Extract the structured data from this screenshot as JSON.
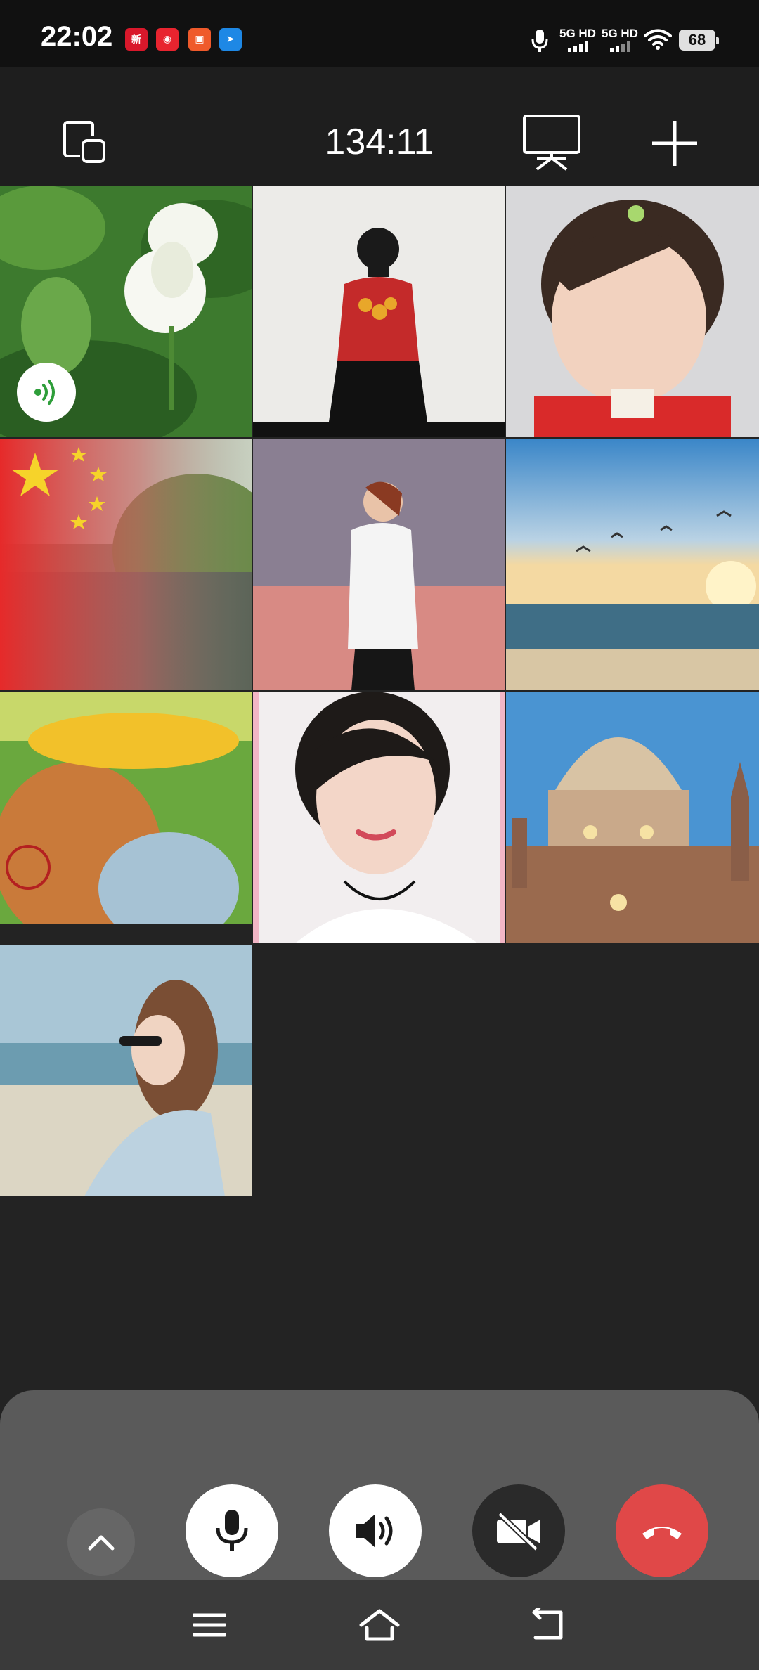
{
  "status_bar": {
    "time": "22:02",
    "network_1": "5G HD",
    "network_2": "5G HD",
    "battery": "68",
    "app_icons": [
      "news-app-icon",
      "music-app-icon",
      "video-app-icon",
      "map-app-icon"
    ],
    "app_icon_colors": [
      "#d9182b",
      "#e8242f",
      "#ef5a2b",
      "#1e88e5"
    ]
  },
  "call": {
    "timer": "134:11",
    "icons": {
      "left": "switch-window-icon",
      "screen": "screen-share-icon",
      "add": "add-participant-icon"
    }
  },
  "participants": [
    {
      "name": "participant-lotus",
      "speaking": true
    },
    {
      "name": "participant-red-sweater"
    },
    {
      "name": "participant-baby"
    },
    {
      "name": "participant-flag-lake"
    },
    {
      "name": "participant-white-coat"
    },
    {
      "name": "participant-sea-sunset"
    },
    {
      "name": "participant-sunflower-hat"
    },
    {
      "name": "participant-smiling-woman"
    },
    {
      "name": "participant-cathedral"
    },
    {
      "name": "participant-beach-woman"
    }
  ],
  "controls": {
    "expand": "chevron-up-icon",
    "mic": "microphone-icon",
    "speaker": "speaker-icon",
    "camera": "camera-off-icon",
    "hangup": "hang-up-icon",
    "hangup_color": "#e04848"
  },
  "nav": {
    "menu": "menu-icon",
    "home": "home-icon",
    "back": "back-icon"
  }
}
